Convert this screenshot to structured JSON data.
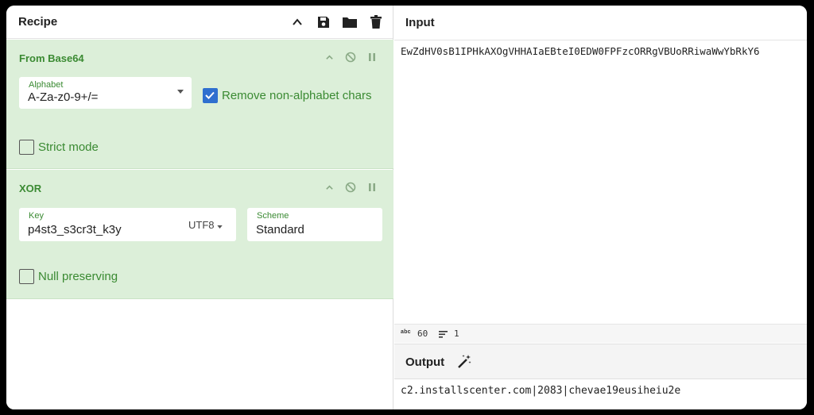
{
  "recipe": {
    "title": "Recipe",
    "icons": [
      "chevron-up-icon",
      "save-icon",
      "folder-icon",
      "trash-icon"
    ]
  },
  "operations": {
    "from_base64": {
      "title": "From Base64",
      "alphabet_label": "Alphabet",
      "alphabet_value": "A-Za-z0-9+/=",
      "remove_label": "Remove non-alphabet chars",
      "remove_checked": true,
      "strict_label": "Strict mode",
      "strict_checked": false
    },
    "xor": {
      "title": "XOR",
      "key_label": "Key",
      "key_value": "p4st3_s3cr3t_k3y",
      "key_encoding": "UTF8",
      "scheme_label": "Scheme",
      "scheme_value": "Standard",
      "null_label": "Null preserving",
      "null_checked": false
    }
  },
  "input": {
    "title": "Input",
    "text": "EwZdHV0sB1IPHkAXOgVHHAIaEBteI0EDW0FPFzcORRgVBUoRRiwaWwYbRkY6",
    "length": "60",
    "lines": "1"
  },
  "output": {
    "title": "Output",
    "text": "c2.installscenter.com|2083|chevae19eusiheiu2e"
  },
  "colors": {
    "accent_green": "#3a8a32",
    "op_background": "#dcefd9",
    "checkbox_blue": "#2f6fcf"
  }
}
